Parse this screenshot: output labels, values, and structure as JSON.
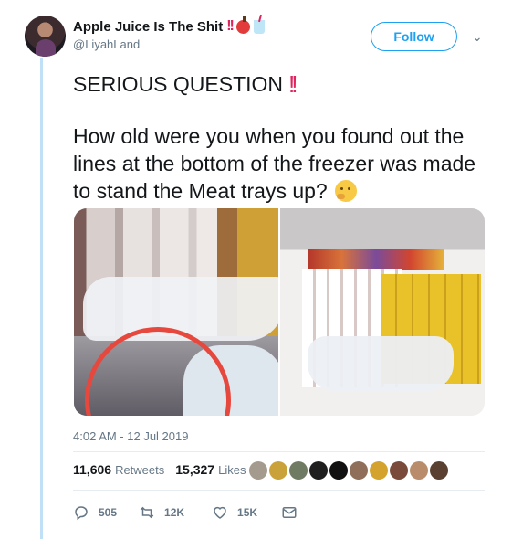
{
  "author": {
    "name": "Apple Juice Is The Shit",
    "name_emojis": [
      "double-exclamation",
      "red-apple",
      "cup-with-straw"
    ],
    "handle": "@LiyahLand",
    "avatar": "avatar-photo"
  },
  "follow_label": "Follow",
  "tweet": {
    "line1": "SERIOUS QUESTION",
    "body": "How old were you when you found out the lines at the bottom of the freezer was made to stand the Meat trays up?",
    "body_emoji": "thinking-face"
  },
  "media": {
    "photos": [
      "freezer-photo-left",
      "freezer-photo-right"
    ]
  },
  "timestamp": "4:02 AM - 12 Jul 2019",
  "stats": {
    "retweets_count": "11,606",
    "retweets_label": "Retweets",
    "likes_count": "15,327",
    "likes_label": "Likes"
  },
  "likers_colors": [
    "#a59a8e",
    "#c9a23b",
    "#6f7b63",
    "#1f1f1f",
    "#111111",
    "#8f6f59",
    "#d4a32d",
    "#7a4b3b",
    "#b98c6b",
    "#5a4030"
  ],
  "actions": {
    "reply_count": "505",
    "retweet_count": "12K",
    "like_count": "15K"
  },
  "colors": {
    "accent": "#1da1f2",
    "thread_line": "#bfe0f6",
    "muted": "#657786",
    "exclamation": "#e0245e"
  }
}
